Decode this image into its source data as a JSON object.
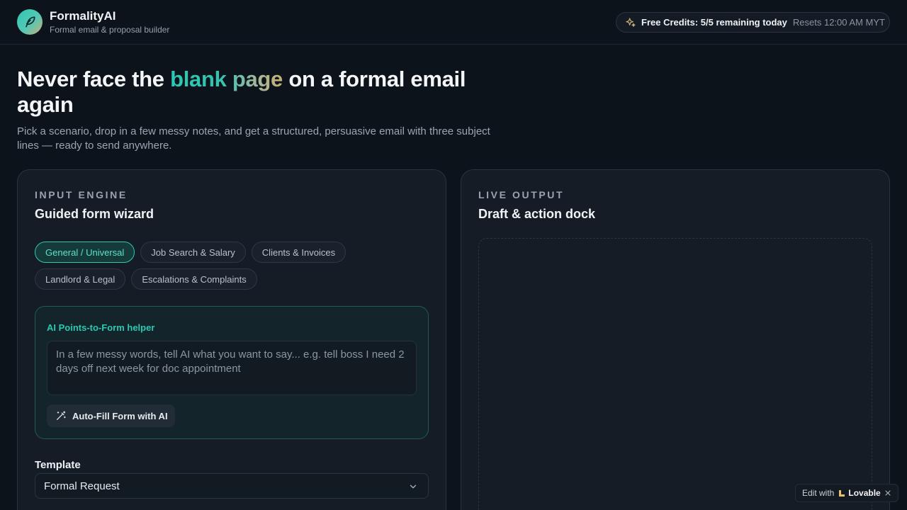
{
  "brand": {
    "name": "FormalityAI",
    "tagline": "Formal email & proposal builder",
    "logo_icon": "feather-pen-icon"
  },
  "credits": {
    "icon": "sparkles-icon",
    "label": "Free Credits: 5/5 remaining today",
    "reset": "Resets 12:00 AM MYT"
  },
  "hero": {
    "title_pre": "Never face the ",
    "title_highlight": "blank page",
    "title_post": " on a formal email again",
    "subtitle": "Pick a scenario, drop in a few messy notes, and get a structured, persuasive email with three subject lines — ready to send anywhere."
  },
  "input_panel": {
    "eyebrow": "INPUT ENGINE",
    "title": "Guided form wizard",
    "chips": [
      {
        "label": "General / Universal",
        "active": true
      },
      {
        "label": "Job Search & Salary",
        "active": false
      },
      {
        "label": "Clients & Invoices",
        "active": false
      },
      {
        "label": "Landlord & Legal",
        "active": false
      },
      {
        "label": "Escalations & Complaints",
        "active": false
      }
    ],
    "helper": {
      "label": "AI Points-to-Form helper",
      "placeholder": "In a few messy words, tell AI what you want to say... e.g. tell boss I need 2 days off next week for doc appointment",
      "value": "",
      "button_label": "Auto-Fill Form with AI",
      "button_icon": "magic-wand-icon"
    },
    "template": {
      "label": "Template",
      "selected": "Formal Request"
    }
  },
  "output_panel": {
    "eyebrow": "LIVE OUTPUT",
    "title": "Draft & action dock"
  },
  "lovable_badge": {
    "prefix": "Edit with",
    "brand": "Lovable"
  },
  "colors": {
    "background": "#0d131b",
    "panel": "#151c26",
    "accent": "#2cc9b2",
    "accent_gold": "#c8ae73"
  }
}
